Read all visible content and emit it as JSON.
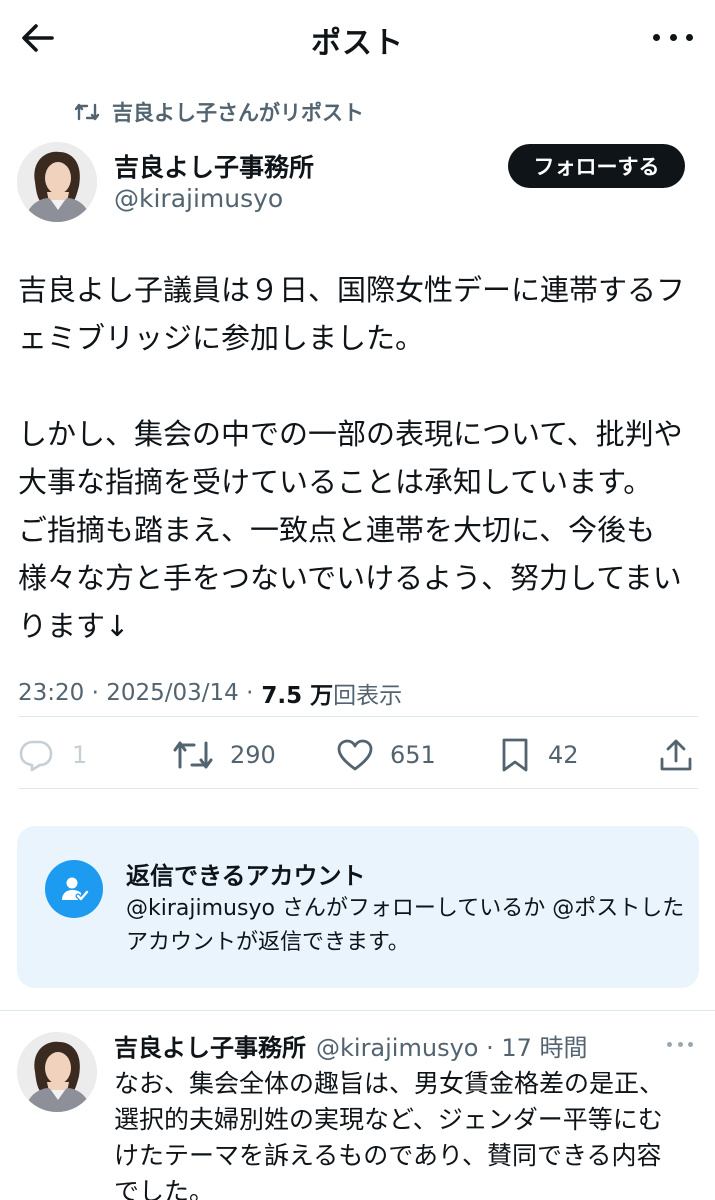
{
  "header": {
    "title": "ポスト"
  },
  "repost": {
    "label": "吉良よし子さんがリポスト"
  },
  "post": {
    "author_name": "吉良よし子事務所",
    "author_handle": "@kirajimusyo",
    "follow_label": "フォローする",
    "lines": [
      "吉良よし子議員は９日、国際女性デーに連帯するフ",
      "ェミブリッジに参加しました。",
      "",
      "しかし、集会の中での一部の表現について、批判や",
      "大事な指摘を受けていることは承知しています。",
      "ご指摘も踏まえ、一致点と連帯を大切に、今後も",
      "様々な方と手をつないでいけるよう、努力してまい",
      "ります↓"
    ],
    "time": "23:20 · 2025/03/14 ·",
    "views_count": "7.5 万",
    "views_label": "回表示"
  },
  "actions": {
    "reply_count": "1",
    "repost_count": "290",
    "like_count": "651",
    "bookmark_count": "42"
  },
  "reply_restriction": {
    "title": "返信できるアカウント",
    "text": "@kirajimusyo さんがフォローしているか @ポストしたアカウントが返信できます。"
  },
  "reply": {
    "author_name": "吉良よし子事務所",
    "meta": "@kirajimusyo · 17 時間",
    "lines": [
      "なお、集会全体の趣旨は、男女賃金格差の是正、",
      "選択的夫婦別姓の実現など、ジェンダー平等にむ",
      "けたテーマを訴えるものであり、賛同できる内容",
      "でした。"
    ]
  },
  "colors": {
    "text": "#0f1419",
    "secondary": "#536471",
    "accent": "#1d9bf0",
    "card_bg": "#e9f4fd"
  }
}
